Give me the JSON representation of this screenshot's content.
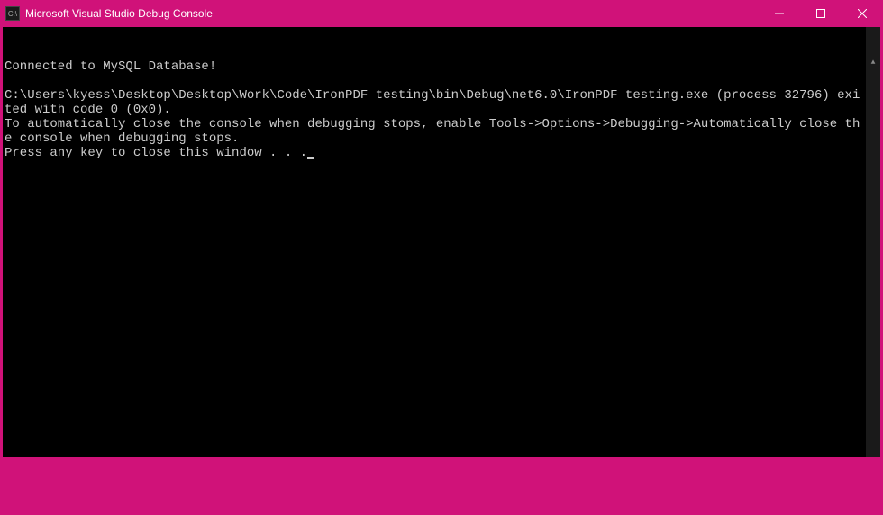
{
  "window": {
    "title": "Microsoft Visual Studio Debug Console",
    "icon_label": "C:\\"
  },
  "console": {
    "lines": [
      "Connected to MySQL Database!",
      "",
      "C:\\Users\\kyess\\Desktop\\Desktop\\Work\\Code\\IronPDF testing\\bin\\Debug\\net6.0\\IronPDF testing.exe (process 32796) exited with code 0 (0x0).",
      "To automatically close the console when debugging stops, enable Tools->Options->Debugging->Automatically close the console when debugging stops.",
      "Press any key to close this window . . ."
    ]
  }
}
